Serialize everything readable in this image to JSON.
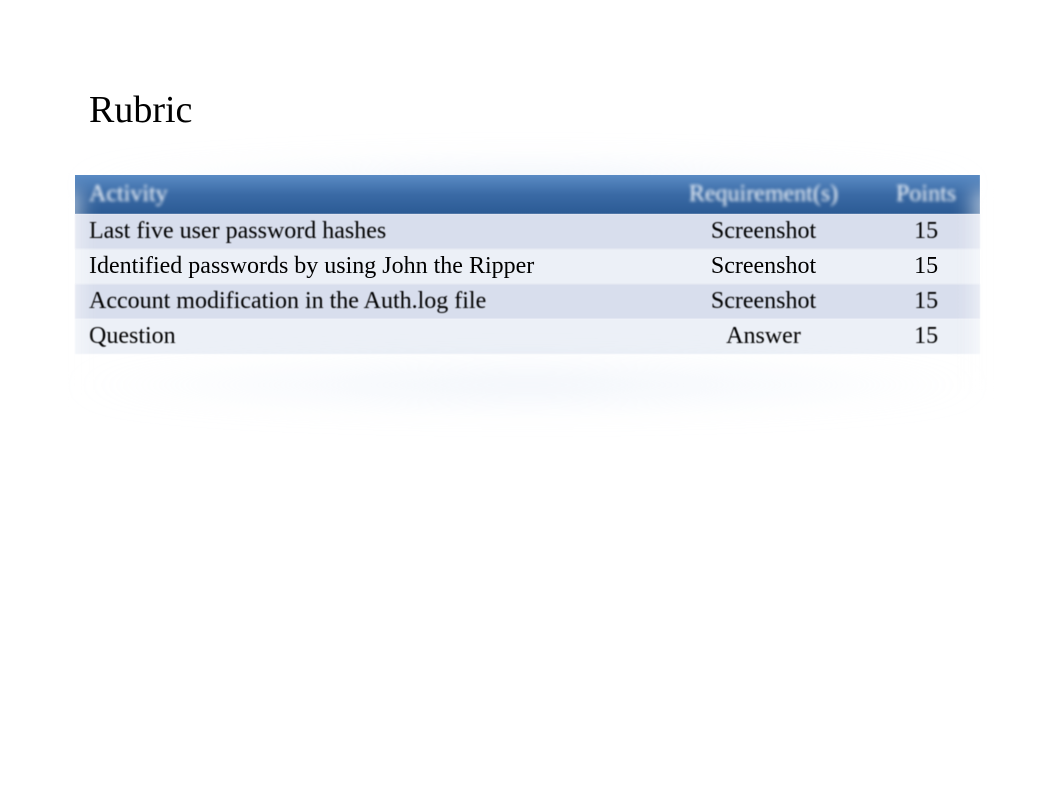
{
  "title": "Rubric",
  "table": {
    "headers": {
      "activity": "Activity",
      "requirement": "Requirement(s)",
      "points": "Points"
    },
    "rows": [
      {
        "activity": "Last five user password hashes",
        "requirement": "Screenshot",
        "points": "15"
      },
      {
        "activity": "Identified passwords by using John the Ripper",
        "requirement": "Screenshot",
        "points": "15"
      },
      {
        "activity": "Account modification in the Auth.log file",
        "requirement": "Screenshot",
        "points": "15"
      },
      {
        "activity": "Question",
        "requirement": "Answer",
        "points": "15"
      }
    ]
  }
}
